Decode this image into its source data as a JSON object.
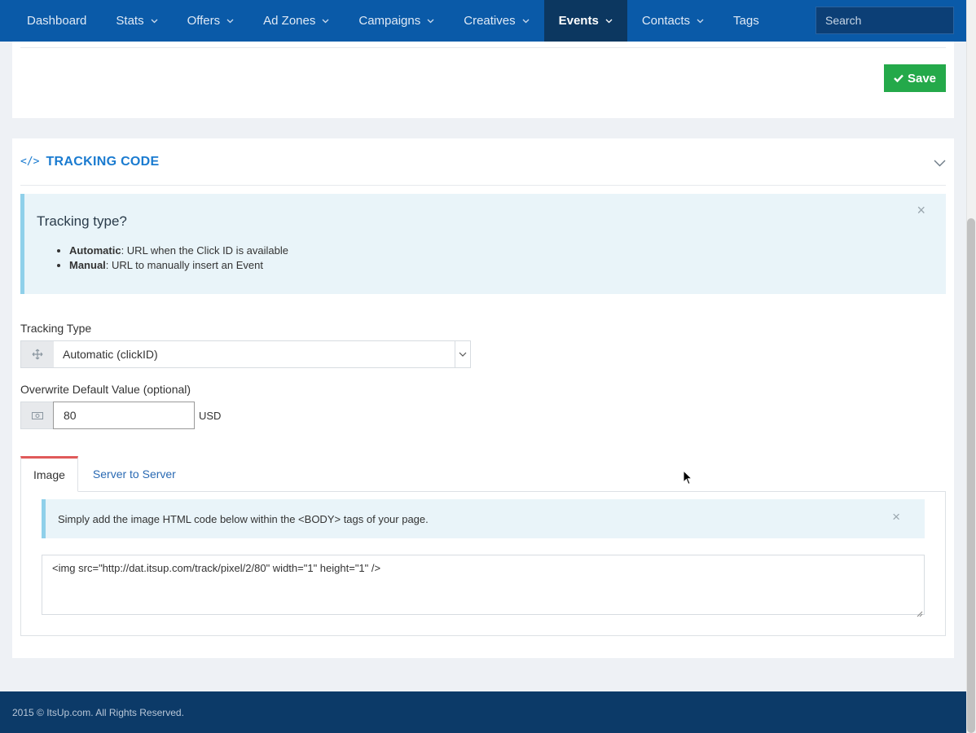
{
  "nav": {
    "items": [
      {
        "label": "Dashboard",
        "caret": false
      },
      {
        "label": "Stats",
        "caret": true
      },
      {
        "label": "Offers",
        "caret": true
      },
      {
        "label": "Ad Zones",
        "caret": true
      },
      {
        "label": "Campaigns",
        "caret": true
      },
      {
        "label": "Creatives",
        "caret": true
      },
      {
        "label": "Events",
        "caret": true,
        "active": true
      },
      {
        "label": "Contacts",
        "caret": true
      },
      {
        "label": "Tags",
        "caret": false
      }
    ],
    "search_placeholder": "Search"
  },
  "top_card": {
    "save_label": "Save"
  },
  "tracking": {
    "title": "TRACKING CODE",
    "info_heading": "Tracking type?",
    "info_items": [
      {
        "term": "Automatic",
        "desc": ": URL when the Click ID is available"
      },
      {
        "term": "Manual",
        "desc": ": URL to manually insert an Event"
      }
    ],
    "tracking_type_label": "Tracking Type",
    "tracking_type_value": "Automatic (clickID)",
    "overwrite_label": "Overwrite Default Value (optional)",
    "overwrite_value": "80",
    "currency": "USD",
    "tabs": [
      {
        "label": "Image",
        "active": true
      },
      {
        "label": "Server to Server",
        "active": false
      }
    ],
    "image_hint": "Simply add the image HTML code below within the <BODY> tags of your page.",
    "image_code": "<img src=\"http://dat.itsup.com/track/pixel/2/80\" width=\"1\" height=\"1\" />"
  },
  "footer": {
    "text": "2015 © ItsUp.com. All Rights Reserved."
  },
  "colors": {
    "nav_bg": "#0a5aa8",
    "nav_active": "#0c3760",
    "accent": "#1a7bd0",
    "save": "#24a94a",
    "footer_bg": "#0c3a68",
    "tab_active_border": "#e05a5a"
  }
}
